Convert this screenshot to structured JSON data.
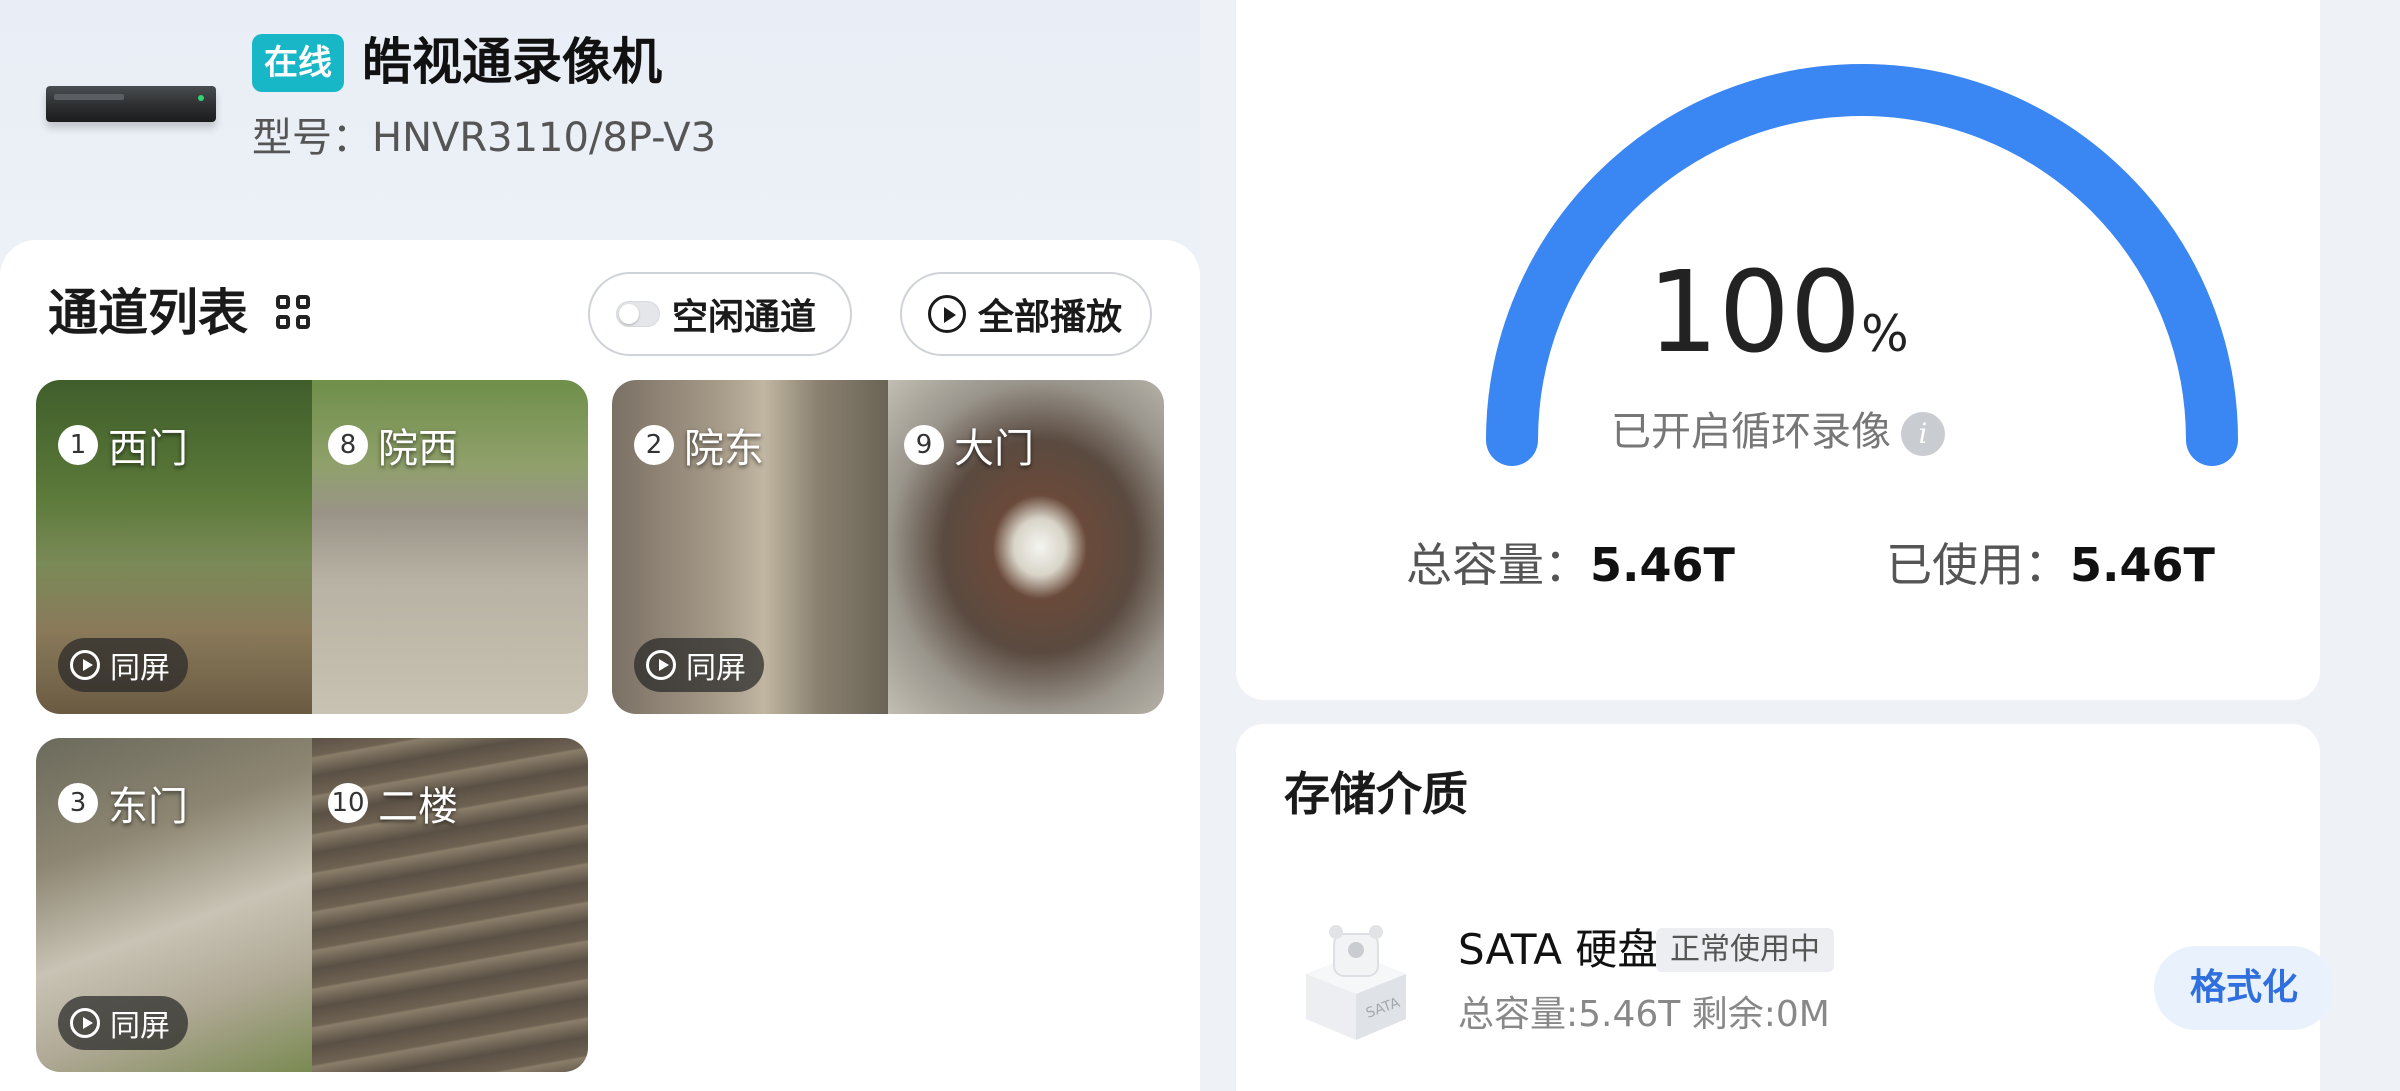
{
  "device": {
    "status": "在线",
    "name": "皓视通录像机",
    "model": "型号：HNVR3110/8P-V3",
    "status_color": "#18b7c7"
  },
  "channels": {
    "title": "通道列表",
    "idle_label": "空闲通道",
    "play_all_label": "全部播放",
    "same_screen_label": "同屏",
    "tiles": [
      {
        "left": {
          "num": "1",
          "name": "西门"
        },
        "right": {
          "num": "8",
          "name": "院西"
        }
      },
      {
        "left": {
          "num": "2",
          "name": "院东"
        },
        "right": {
          "num": "9",
          "name": "大门"
        }
      },
      {
        "left": {
          "num": "3",
          "name": "东门"
        },
        "right": {
          "num": "10",
          "name": "二楼"
        }
      }
    ]
  },
  "storage": {
    "percent": "100",
    "percent_unit": "%",
    "percent_value": 1.0,
    "loop_text": "已开启循环录像",
    "info_icon": "i",
    "total_label": "总容量：",
    "total_value": "5.46T",
    "used_label": "已使用：",
    "used_value": "5.46T",
    "gauge_color": "#3a86f2"
  },
  "media": {
    "title": "存储介质",
    "disk_name": "SATA 硬盘",
    "disk_status": "正常使用中",
    "disk_detail": "总容量:5.46T   剩余:0M",
    "disk_icon_text": "SATA",
    "format_label": "格式化"
  }
}
